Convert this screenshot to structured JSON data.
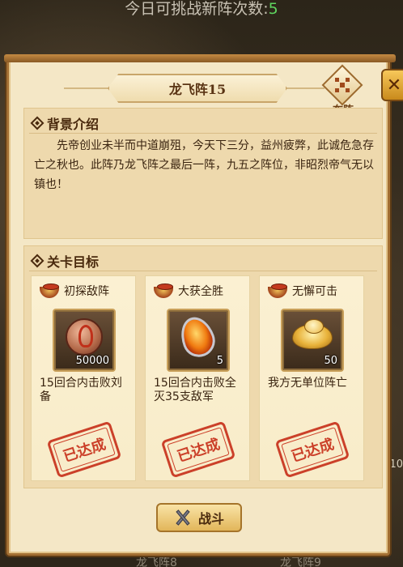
{
  "top_counter": {
    "label": "今日可挑战新阵次数:",
    "value": "5"
  },
  "dialog": {
    "title": "龙飞阵15",
    "formation_label": "布阵",
    "close_icon": "close-x-icon"
  },
  "background_section": {
    "title": "背景介绍",
    "text": "先帝创业未半而中道崩殂，今天下三分，益州疲弊，此诚危急存亡之秋也。此阵乃龙飞阵之最后一阵，九五之阵位，非昭烈帝气无以镇也！"
  },
  "goals_section": {
    "title": "关卡目标",
    "cards": [
      {
        "name": "初探敌阵",
        "reward_icon": "copper-coin-icon",
        "count": "50000",
        "desc": "15回合内击败刘备",
        "stamp": "已达成"
      },
      {
        "name": "大获全胜",
        "reward_icon": "fire-gem-icon",
        "count": "5",
        "desc": "15回合内击败全灭35支敌军",
        "stamp": "已达成"
      },
      {
        "name": "无懈可击",
        "reward_icon": "gold-ingot-icon",
        "count": "50",
        "desc": "我方无单位阵亡",
        "stamp": "已达成"
      }
    ]
  },
  "fight_button": {
    "label": "战斗"
  },
  "background_ghosts": {
    "left_bottom": "龙飞阵8",
    "right_bottom": "龙飞阵9",
    "side": "10"
  },
  "colors": {
    "accent_green": "#5fd45f",
    "stamp_red": "#c8321c",
    "frame_brown": "#a36f33"
  }
}
